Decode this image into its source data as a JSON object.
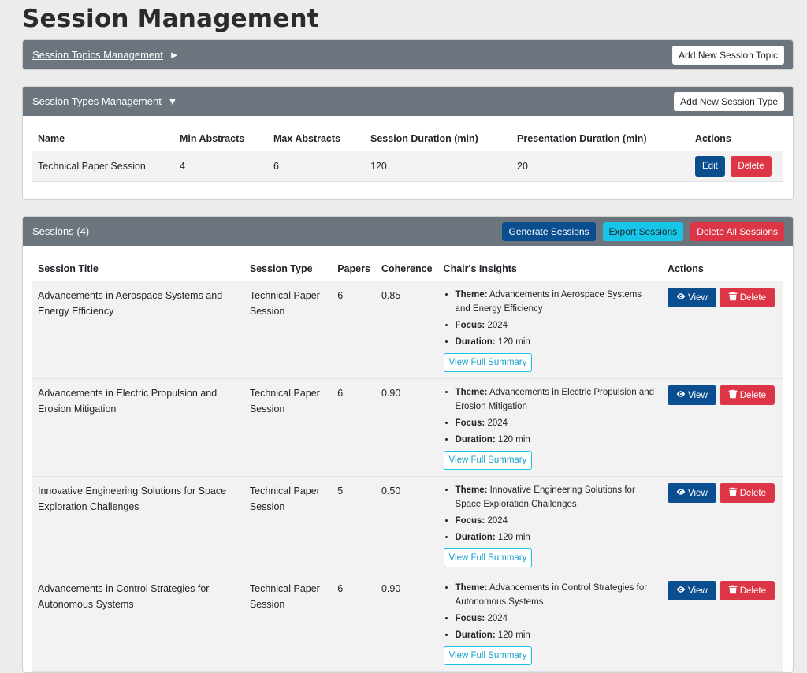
{
  "page": {
    "title": "Session Management"
  },
  "topics": {
    "toggle_label": "Session Topics Management",
    "arrow": "►",
    "add_button": "Add New Session Topic"
  },
  "types": {
    "toggle_label": "Session Types Management",
    "arrow": "▼",
    "add_button": "Add New Session Type",
    "columns": [
      "Name",
      "Min Abstracts",
      "Max Abstracts",
      "Session Duration (min)",
      "Presentation Duration (min)",
      "Actions"
    ],
    "rows": [
      {
        "name": "Technical Paper Session",
        "min": "4",
        "max": "6",
        "session_duration": "120",
        "presentation_duration": "20",
        "edit": "Edit",
        "delete": "Delete"
      }
    ]
  },
  "sessions": {
    "title": "Sessions (4)",
    "generate_button": "Generate Sessions",
    "export_button": "Export Sessions",
    "delete_all_button": "Delete All Sessions",
    "columns": [
      "Session Title",
      "Session Type",
      "Papers",
      "Coherence",
      "Chair's Insights",
      "Actions"
    ],
    "labels": {
      "theme": "Theme:",
      "focus": "Focus:",
      "duration": "Duration:",
      "summary": "View Full Summary",
      "view": "View",
      "delete": "Delete"
    },
    "rows": [
      {
        "title": "Advancements in Aerospace Systems and Energy Efficiency",
        "type": "Technical Paper Session",
        "papers": "6",
        "coherence": "0.85",
        "theme": "Advancements in Aerospace Systems and Energy Efficiency",
        "focus": "2024",
        "duration": "120 min"
      },
      {
        "title": "Advancements in Electric Propulsion and Erosion Mitigation",
        "type": "Technical Paper Session",
        "papers": "6",
        "coherence": "0.90",
        "theme": "Advancements in Electric Propulsion and Erosion Mitigation",
        "focus": "2024",
        "duration": "120 min"
      },
      {
        "title": "Innovative Engineering Solutions for Space Exploration Challenges",
        "type": "Technical Paper Session",
        "papers": "5",
        "coherence": "0.50",
        "theme": "Innovative Engineering Solutions for Space Exploration Challenges",
        "focus": "2024",
        "duration": "120 min"
      },
      {
        "title": "Advancements in Control Strategies for Autonomous Systems",
        "type": "Technical Paper Session",
        "papers": "6",
        "coherence": "0.90",
        "theme": "Advancements in Control Strategies for Autonomous Systems",
        "focus": "2024",
        "duration": "120 min"
      }
    ]
  },
  "icons": {
    "view": "eye-icon",
    "delete": "trash-icon"
  },
  "colors": {
    "header": "#6c757d",
    "primary": "#0b4e8f",
    "info": "#17c5e6",
    "danger": "#dc3545"
  }
}
